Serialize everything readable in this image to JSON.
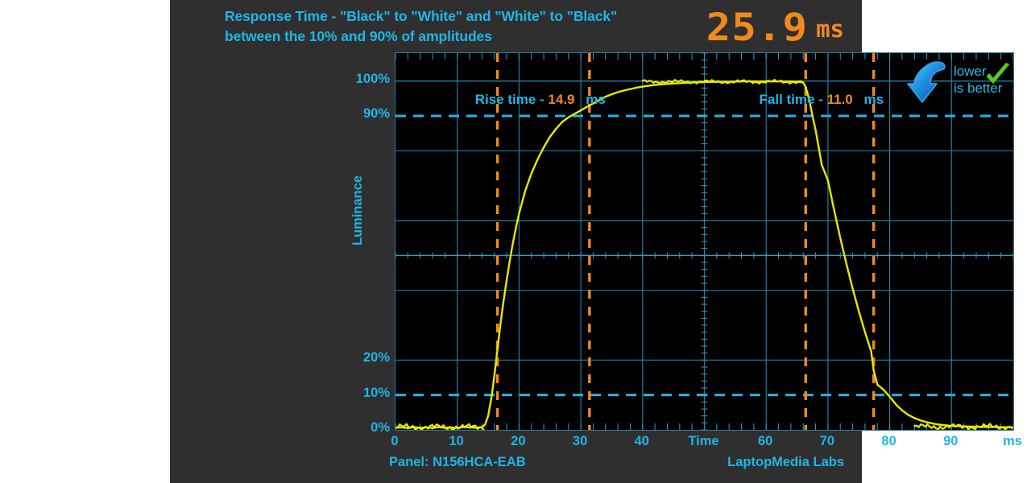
{
  "title": {
    "line1": "Response Time - \"Black\" to \"White\" and \"White\" to \"Black\"",
    "line2": "between the 10% and 90% of amplitudes"
  },
  "readout": {
    "value": "25.9",
    "unit": "ms"
  },
  "badge": {
    "line1": "lower",
    "line2": "is better",
    "arrow_icon": "curved-down-arrow-icon",
    "check_icon": "green-check-icon"
  },
  "annotations": {
    "rise": {
      "label": "Rise time -",
      "value": "14.9",
      "unit": "ms"
    },
    "fall": {
      "label": "Fall time -",
      "value": "11.0",
      "unit": "ms"
    }
  },
  "footer": {
    "panel": "Panel: N156HCA-EAB",
    "brand": "LaptopMedia Labs"
  },
  "colors": {
    "accent_cyan": "#1fb6e8",
    "value_orange": "#f08a1e",
    "trace_yellow": "#e8e800",
    "marker_orange": "#f08a1e",
    "card_bg": "#2f2f2f",
    "plot_bg": "#000000",
    "grid": "#1d7fa0"
  },
  "chart_data": {
    "type": "line",
    "title": "Response Time - \"Black\" to \"White\" and \"White\" to \"Black\" between the 10% and 90% of amplitudes",
    "xlabel": "Time",
    "xunit": "ms",
    "ylabel": "Luminance",
    "xlim": [
      0,
      100
    ],
    "ylim": [
      0,
      108
    ],
    "grid": true,
    "legend": "none",
    "xticks": [
      0,
      10,
      20,
      30,
      40,
      50,
      60,
      70,
      80,
      90,
      100
    ],
    "xticklabels": [
      "0",
      "10",
      "20",
      "30",
      "40",
      "Time",
      "60",
      "70",
      "80",
      "90",
      "ms"
    ],
    "yticks": [
      0,
      10,
      20,
      90,
      100
    ],
    "yticklabels": [
      "0%",
      "10%",
      "20%",
      "90%",
      "100%"
    ],
    "reference_lines": [
      {
        "axis": "y",
        "value": 10,
        "style": "dashed",
        "color": "#1fb6e8"
      },
      {
        "axis": "y",
        "value": 90,
        "style": "dashed",
        "color": "#1fb6e8"
      },
      {
        "axis": "y",
        "value": 100,
        "style": "solid",
        "color": "#1d7fa0"
      }
    ],
    "markers": [
      {
        "axis": "x",
        "value": 16.5,
        "style": "dashed",
        "color": "#f08a1e",
        "note": "rise start (10%)"
      },
      {
        "axis": "x",
        "value": 31.4,
        "style": "dashed",
        "color": "#f08a1e",
        "note": "rise end (90%)"
      },
      {
        "axis": "x",
        "value": 66.4,
        "style": "dashed",
        "color": "#f08a1e",
        "note": "fall start (90%)"
      },
      {
        "axis": "x",
        "value": 77.4,
        "style": "dashed",
        "color": "#f08a1e",
        "note": "fall end (10%)"
      }
    ],
    "measurements": {
      "total_response_time_ms": 25.9,
      "rise_time_ms": 14.9,
      "fall_time_ms": 11.0
    },
    "series": [
      {
        "name": "Luminance",
        "color": "#e8e800",
        "x": [
          0,
          1,
          2,
          3,
          4,
          5,
          6,
          7,
          8,
          9,
          10,
          11,
          12,
          13,
          14,
          14.5,
          15,
          15.3,
          15.6,
          16,
          16.5,
          17,
          17.5,
          18,
          18.5,
          19,
          19.5,
          20,
          21,
          22,
          23,
          24,
          25,
          26,
          27,
          28,
          29,
          30,
          31,
          31.4,
          32,
          33,
          34,
          35,
          36,
          37,
          38,
          39,
          40,
          42,
          44,
          46,
          48,
          50,
          52,
          54,
          56,
          58,
          60,
          62,
          64,
          65,
          66,
          66.4,
          67,
          67.5,
          68,
          68.5,
          69,
          70,
          71,
          72,
          73,
          74,
          75,
          76,
          77,
          77.4,
          78,
          79,
          80,
          81,
          82,
          83,
          84,
          85,
          86,
          87,
          88,
          89,
          90,
          92,
          94,
          96,
          98,
          100
        ],
        "y": [
          0.6,
          0.7,
          0.5,
          0.8,
          0.6,
          0.7,
          0.5,
          0.8,
          0.6,
          0.7,
          0.6,
          0.8,
          0.7,
          0.6,
          0.8,
          1.5,
          4.0,
          7.0,
          10.0,
          15.5,
          23.0,
          30.5,
          37.0,
          43.0,
          48.5,
          53.5,
          58.0,
          62.0,
          68.5,
          73.5,
          77.5,
          81.0,
          84.0,
          86.3,
          88.3,
          89.6,
          90.6,
          91.6,
          92.6,
          93.0,
          93.6,
          94.6,
          95.5,
          96.2,
          96.8,
          97.3,
          97.7,
          98.1,
          98.4,
          98.9,
          99.2,
          99.4,
          99.6,
          99.7,
          99.8,
          99.8,
          99.9,
          99.9,
          99.9,
          99.9,
          99.9,
          99.8,
          99.6,
          98.3,
          94.5,
          90.0,
          86.0,
          81.0,
          76.0,
          71.5,
          63.0,
          55.0,
          47.5,
          40.5,
          34.0,
          28.0,
          22.5,
          17.0,
          13.0,
          11.5,
          9.5,
          7.3,
          5.6,
          4.3,
          3.4,
          2.7,
          2.2,
          1.8,
          1.5,
          1.3,
          1.1,
          1.0,
          0.9,
          0.8,
          0.8,
          0.7,
          0.8,
          0.7
        ]
      }
    ]
  }
}
